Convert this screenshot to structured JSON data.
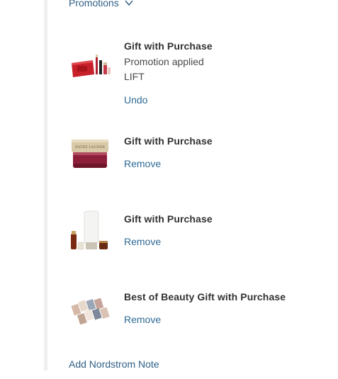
{
  "promotions": {
    "toggle_label": "Promotions"
  },
  "items": [
    {
      "title": "Gift with Purchase",
      "status": "Promotion applied",
      "code": "LIFT",
      "action": "Undo"
    },
    {
      "title": "Gift with Purchase",
      "action": "Remove"
    },
    {
      "title": "Gift with Purchase",
      "action": "Remove"
    },
    {
      "title": "Best of Beauty Gift with Purchase",
      "action": "Remove"
    }
  ],
  "footer": {
    "add_note_label": "Add Nordstrom Note"
  },
  "colors": {
    "link": "#2f6a95",
    "title": "#333333",
    "rail": "#efefef"
  }
}
